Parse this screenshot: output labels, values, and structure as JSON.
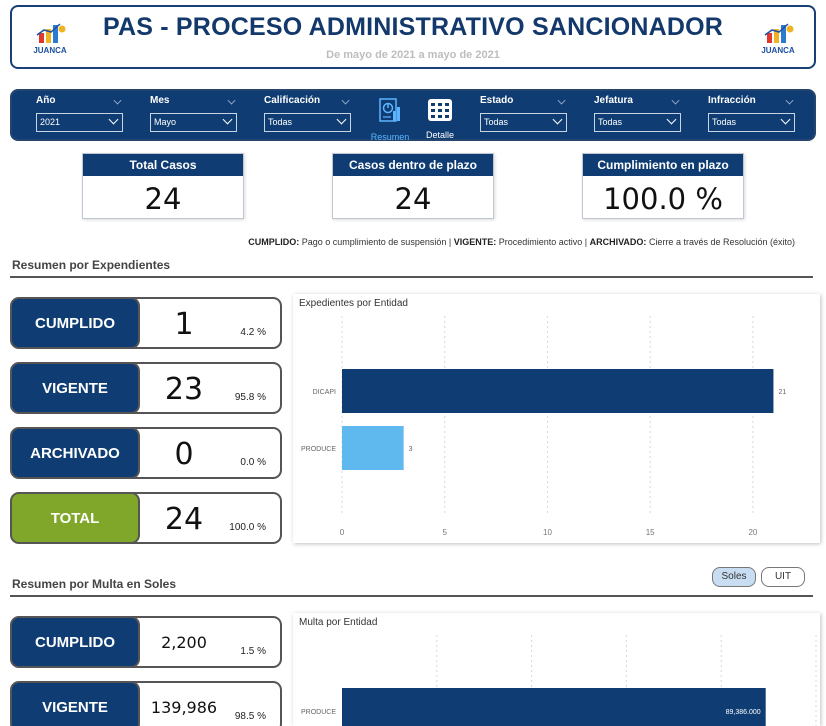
{
  "header": {
    "title": "PAS - PROCESO ADMINISTRATIVO SANCIONADOR",
    "subtitle": "De mayo de 2021 a mayo de 2021",
    "logo_text": "JUANCA"
  },
  "filters": [
    {
      "label": "Año",
      "value": "2021"
    },
    {
      "label": "Mes",
      "value": "Mayo"
    },
    {
      "label": "Calificación",
      "value": "Todas"
    },
    {
      "label": "Estado",
      "value": "Todas"
    },
    {
      "label": "Jefatura",
      "value": "Todas"
    },
    {
      "label": "Infracción",
      "value": "Todas"
    }
  ],
  "nav": {
    "resumen": {
      "label": "Resumen",
      "icon": "report-icon"
    },
    "detalle": {
      "label": "Detalle",
      "icon": "table-icon"
    }
  },
  "kpis": [
    {
      "label": "Total Casos",
      "value": "24"
    },
    {
      "label": "Casos dentro de plazo",
      "value": "24"
    },
    {
      "label": "Cumplimiento en plazo",
      "value": "100.0 %"
    }
  ],
  "legend_note": {
    "cumplido_key": "CUMPLIDO:",
    "cumplido_text": " Pago o cumplimiento de suspensión",
    "sep": " | ",
    "vigente_key": "VIGENTE:",
    "vigente_text": " Procedimiento activo",
    "archivado_key": "ARCHIVADO:",
    "archivado_text": " Cierre a través de Resolución (éxito)"
  },
  "section_expedientes": {
    "title": "Resumen por Expendientes",
    "cards": [
      {
        "label": "CUMPLIDO",
        "value": "1",
        "pct": "4.2 %"
      },
      {
        "label": "VIGENTE",
        "value": "23",
        "pct": "95.8 %"
      },
      {
        "label": "ARCHIVADO",
        "value": "0",
        "pct": "0.0 %"
      },
      {
        "label": "TOTAL",
        "value": "24",
        "pct": "100.0 %"
      }
    ]
  },
  "section_multa": {
    "title": "Resumen por Multa en Soles",
    "toggle_soles": "Soles",
    "toggle_uit": "UIT",
    "cards": [
      {
        "label": "CUMPLIDO",
        "value": "2,200",
        "pct": "1.5 %"
      },
      {
        "label": "VIGENTE",
        "value": "139,986",
        "pct": "98.5 %"
      }
    ]
  },
  "colors": {
    "navy": "#0f3d73",
    "bar_dark": "#0f3d73",
    "bar_light": "#5fb8ee",
    "total_green": "#80a72a"
  },
  "chart_data": [
    {
      "type": "bar",
      "orientation": "horizontal",
      "title": "Expedientes por Entidad",
      "categories": [
        "DICAPI",
        "PRODUCE"
      ],
      "values": [
        21,
        3
      ],
      "data_labels": [
        "21",
        "3"
      ],
      "xlim": [
        0,
        22
      ],
      "xticks": [
        0,
        5,
        10,
        15,
        20
      ],
      "grid": true
    },
    {
      "type": "bar",
      "orientation": "horizontal",
      "title": "Multa por Entidad",
      "categories": [
        "PRODUCE"
      ],
      "values": [
        89386
      ],
      "data_labels": [
        "89,386.000"
      ],
      "xlim": [
        0,
        100000
      ],
      "grid": true
    }
  ]
}
